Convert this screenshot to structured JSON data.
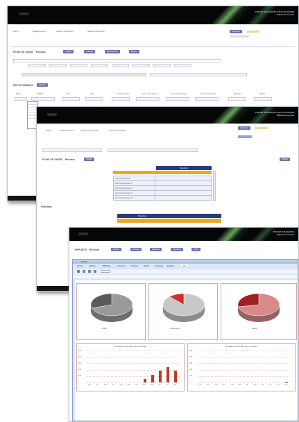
{
  "shot1": {
    "header": {
      "line1": "PROJET SOLIDARITÉ DANS LE MONDE",
      "line2": "Tablette du compte"
    },
    "nav": {
      "item1": "Menu",
      "item2": "Rattachement",
      "item3": "Gestion de la fiche",
      "item4": "Gestion de la fiche",
      "item5": "Rattachement"
    },
    "badge": "Imprimer",
    "section_title": "FICHE DE SAISIE",
    "section_subtitle": "Résultat",
    "buttons": [
      "Valider",
      "Annuler",
      "Rechercher",
      "Export"
    ],
    "second_section": "RATTACHEMENT",
    "second_button": "Ajouter",
    "grid_headers": [
      "Date",
      "Libellé",
      "N°",
      "Qté",
      "Commentaire",
      "Cat. Fournisseur",
      "Cat. Fournisseur",
      "Cat. Fournisseur",
      "Montant",
      "Statut"
    ]
  },
  "shot2": {
    "header": {
      "line1": "PROJET SOLIDARITÉ DANS LE MONDE",
      "line2": "Tablette du compte"
    },
    "nav": {
      "item1": "Menu",
      "item2": "Rattachement",
      "item3": "Gestion de la fiche",
      "item4": "Gestion de la fiche"
    },
    "badge": "Imprimer",
    "section_title": "FICHE DE SAISIE",
    "section_subtitle": "Résultat",
    "button": "Valider",
    "right_button": "Valider",
    "table_header": "Sélection",
    "table_rows": [
      "Cat. Fournisseur",
      "Cat. Fournisseur 2",
      "Cat. Fournisseur 3",
      "Cat. Fournisseur 4",
      "Cat. Fournisseur 5"
    ],
    "left_label": "Résultats",
    "bottom_table_header": "Sélection"
  },
  "shot3": {
    "header": {
      "line1": "PROJET SOLIDARITÉ",
      "line2": "Tablette du compte"
    },
    "title": "REPORTS",
    "title_sub": "Résultat",
    "buttons": [
      "Valider",
      "Annuler",
      "Exporter",
      "Imprimer",
      "Filtre"
    ],
    "toolbar_title": "Report",
    "menu_items": [
      "Fichier",
      "Édition",
      "Affichage",
      "Insertion",
      "Format",
      "Outils",
      "Données",
      "Fenêtre",
      "Aide"
    ],
    "pie_labels": [
      "Total",
      "Sous-total",
      "Reste"
    ],
    "bar_titles": [
      "Evolution mensuelle des montants",
      "Evolution mensuelle des montants"
    ],
    "month_ticks": [
      "jan",
      "fév",
      "mar",
      "avr",
      "mai",
      "juin",
      "juil",
      "aoû",
      "sep",
      "oct",
      "nov",
      "déc"
    ],
    "y_ticks": [
      "500",
      "400",
      "300",
      "200",
      "100",
      "0"
    ]
  },
  "chart_data": [
    {
      "type": "pie",
      "title": "",
      "values": [
        70,
        30
      ],
      "colors": [
        "#9a9a9a",
        "#5a5a5a"
      ]
    },
    {
      "type": "pie",
      "title": "",
      "values": [
        88,
        12
      ],
      "colors": [
        "#c8c8c8",
        "#d03030"
      ]
    },
    {
      "type": "pie",
      "title": "",
      "values": [
        72,
        28
      ],
      "colors": [
        "#d88a8a",
        "#a02020"
      ]
    },
    {
      "type": "bar",
      "title": "Evolution mensuelle des montants",
      "categories": [
        "jan",
        "fév",
        "mar",
        "avr",
        "mai",
        "juin",
        "juil",
        "aoû",
        "sep",
        "oct",
        "nov",
        "déc"
      ],
      "values": [
        0,
        0,
        0,
        0,
        0,
        0,
        0,
        50,
        120,
        180,
        240,
        180
      ],
      "ylim": [
        0,
        500
      ]
    },
    {
      "type": "bar",
      "title": "Evolution mensuelle des montants",
      "categories": [
        "jan",
        "fév",
        "mar",
        "avr",
        "mai",
        "juin",
        "juil",
        "aoû",
        "sep",
        "oct",
        "nov",
        "déc"
      ],
      "values": [
        0,
        0,
        0,
        0,
        0,
        0,
        0,
        0,
        0,
        0,
        0,
        5
      ],
      "ylim": [
        0,
        500
      ]
    }
  ]
}
